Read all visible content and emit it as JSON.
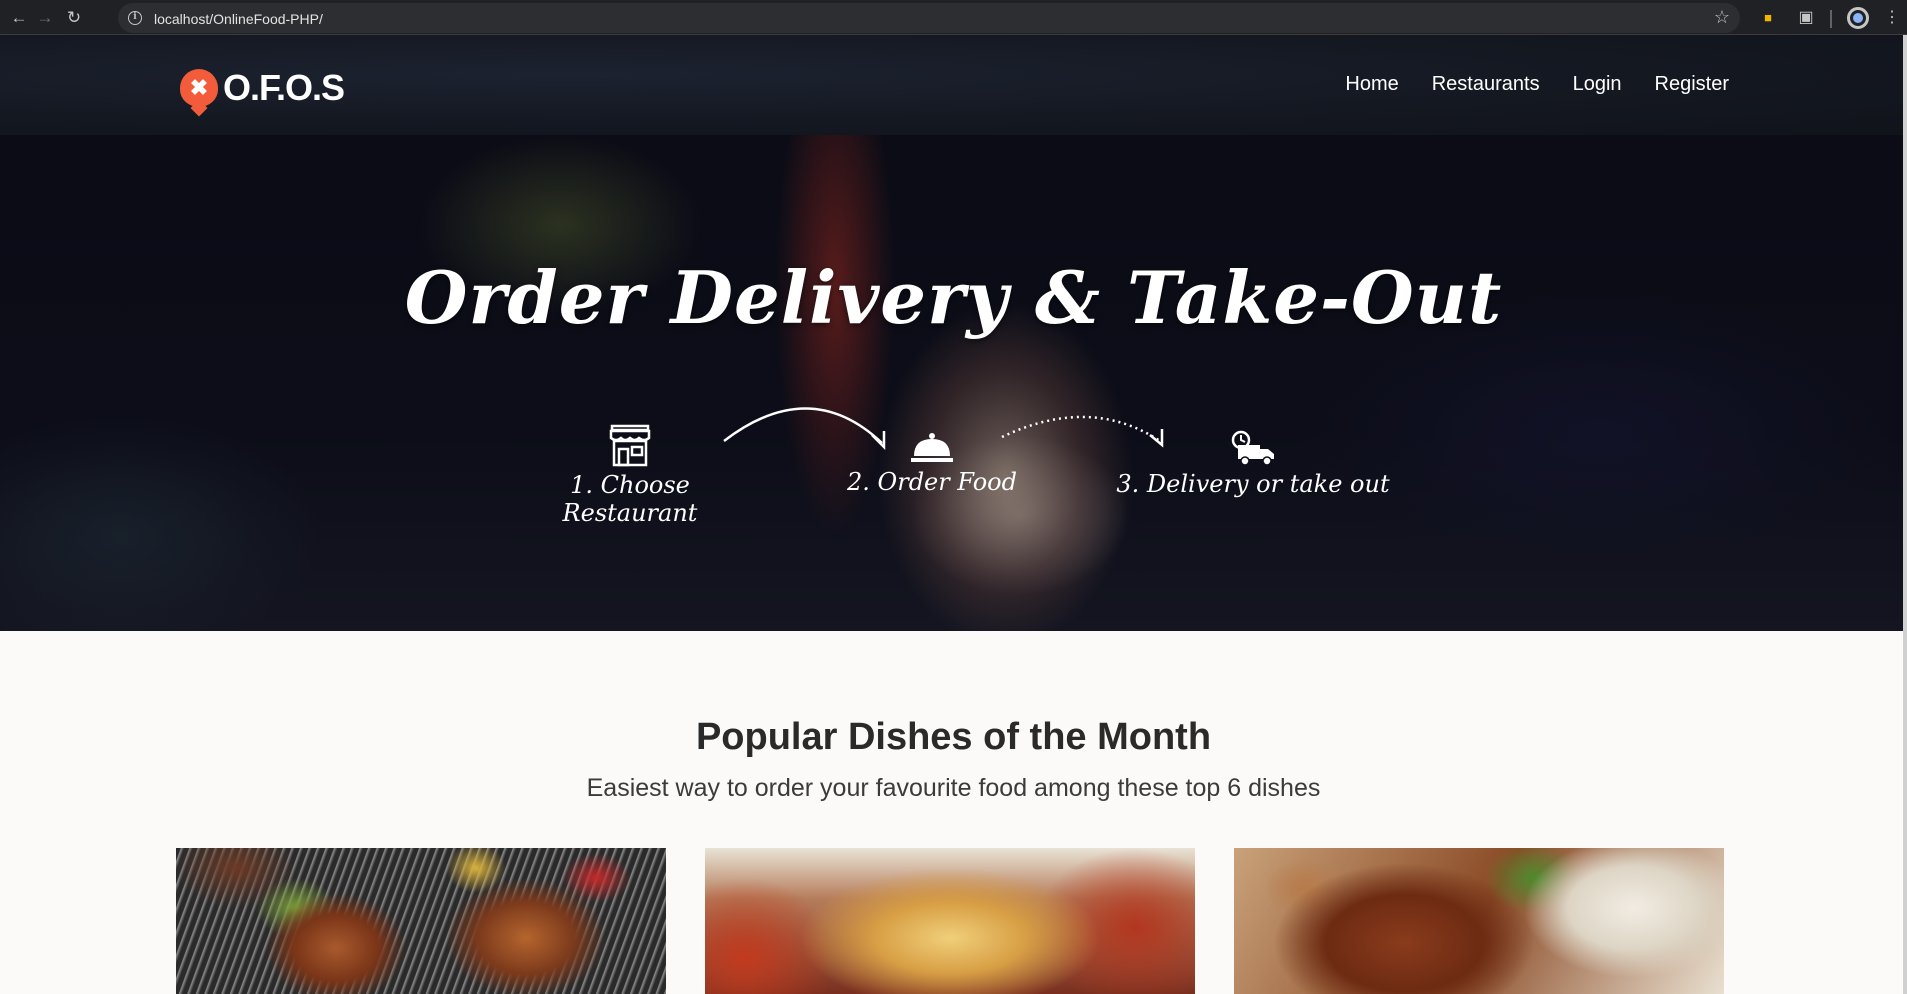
{
  "browser": {
    "url": "localhost/OnlineFood-PHP/",
    "icons": [
      "back-icon",
      "forward-icon",
      "reload-icon",
      "site-info-icon",
      "bookmark-star-icon",
      "extension-lock-icon",
      "extensions-puzzle-icon",
      "profile-icon",
      "menu-icon"
    ]
  },
  "header": {
    "brand": "O.F.O.S",
    "nav": [
      {
        "label": "Home"
      },
      {
        "label": "Restaurants"
      },
      {
        "label": "Login"
      },
      {
        "label": "Register"
      }
    ]
  },
  "hero": {
    "title": "Order Delivery & Take-Out",
    "steps": [
      {
        "label": "1. Choose Restaurant",
        "icon": "storefront-icon"
      },
      {
        "label": "2. Order Food",
        "icon": "cloche-icon"
      },
      {
        "label": "3. Delivery or take out",
        "icon": "delivery-truck-icon"
      }
    ]
  },
  "popular": {
    "title": "Popular Dishes of the Month",
    "subtitle": "Easiest way to order your favourite food among these top 6 dishes"
  },
  "colors": {
    "brand_accent": "#f25c3b",
    "header_bg": "#141821",
    "section_bg": "#fbfaf8"
  }
}
